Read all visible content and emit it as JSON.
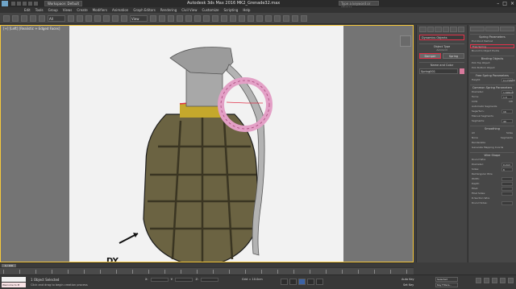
{
  "titlebar": {
    "workspace": "Workspace: Default",
    "title": "Autodesk 3ds Max 2016    MK2_Grenade32.max",
    "search_placeholder": "Type a keyword or phrase",
    "minimize": "–",
    "maximize": "□",
    "close": "×"
  },
  "menu": [
    "Edit",
    "Tools",
    "Group",
    "Views",
    "Create",
    "Modifiers",
    "Animation",
    "Graph Editors",
    "Rendering",
    "Civil View",
    "Customize",
    "Scripting",
    "Help"
  ],
  "toolbar": {
    "selection_filter": "All",
    "view_dropdown": "View"
  },
  "viewport": {
    "label": "[+] [Left] [Realistic + Edged Faces]",
    "annotation": "DY"
  },
  "command_panel": {
    "category_dropdown": "Dynamics Objects",
    "object_type": "Object Type",
    "autogrid": "AutoGrid",
    "btn_damper": "Damper",
    "btn_spring": "Spring",
    "name_and_color": "Name and Color",
    "object_name": "Spring001"
  },
  "parameters": {
    "rollout_spring_params": "Spring Parameters",
    "end_point_method": "End Point Method",
    "free_spring": "Free Spring",
    "bound_to_object_pivots": "Bound to Object Pivots",
    "binding_objects": "Binding Objects",
    "pick_top_object": "Pick Top Object",
    "pick_bottom_object": "Pick Bottom Object",
    "free_spring_parameters": "Free Spring Parameters",
    "height_label": "Height:",
    "height_value": "0.1748cm",
    "common_spring_params": "Common Spring Parameters",
    "diameter_label": "Diameter:",
    "diameter_value": "1.696cm",
    "turns_label": "Turns:",
    "turns_value": "1.0",
    "ccw": "CCW",
    "cw": "CW",
    "automatic_segments": "Automatic Segments",
    "segs_turn_label": "Segs/Turn:",
    "segs_turn_value": "16",
    "manual_segments": "Manual Segments",
    "segments_label": "Segments:",
    "segments_value": "40",
    "smoothing": "Smoothing",
    "all": "All",
    "sides": "Sides",
    "none": "None",
    "segments_opt": "Segments",
    "renderable": "Renderable",
    "gen_mapping": "Generate Mapping Coords",
    "wire_shape": "Wire Shape",
    "round_wire": "Round Wire",
    "rw_diameter_label": "Diameter:",
    "rw_diameter_value": "0.2cm",
    "rw_sides_label": "Sides:",
    "rw_sides_value": "6",
    "rect_wire": "Rectangular Wire",
    "width_label": "Width:",
    "depth_label": "Depth:",
    "fillet_label": "Fillet:",
    "fillet_sides_label": "Fillet Sides:",
    "d_section": "D-Section Wire",
    "round_sides_label": "Round Sides:"
  },
  "timeline": {
    "frame": "0 / 100"
  },
  "status": {
    "maxscript": "",
    "welcome": "Welcome to M",
    "selection": "1 Object Selected",
    "prompt": "Click and drag to begin creation process",
    "x_label": "X:",
    "y_label": "Y:",
    "z_label": "Z:",
    "grid": "Grid = 10.0cm",
    "auto_key": "Auto Key",
    "set_key": "Set Key",
    "selected": "Selected",
    "key_filters": "Key Filters..."
  },
  "colors": {
    "accent": "#3b62a5",
    "highlight": "#e0324a",
    "spring": "#e3a0c6",
    "body": "#6b6342"
  }
}
